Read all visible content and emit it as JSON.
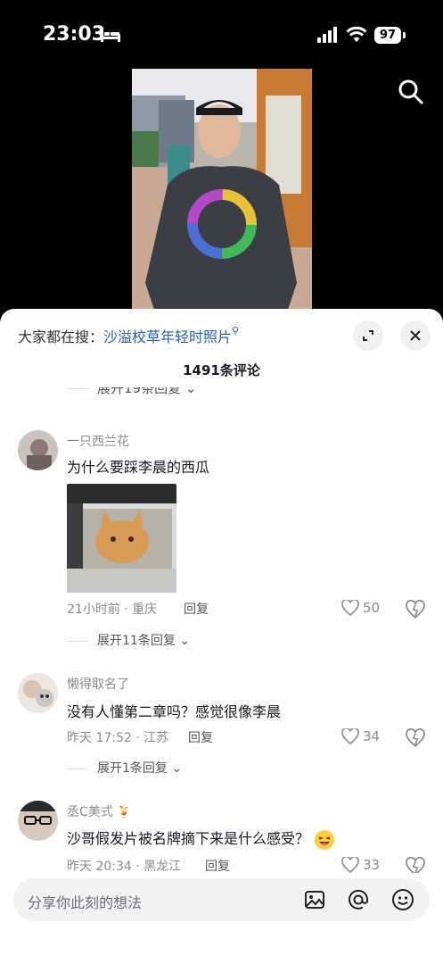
{
  "status_bar": {
    "time": "23:03",
    "battery": "97",
    "icons": [
      "bed-icon",
      "signal-icon",
      "wifi-icon",
      "battery-icon"
    ]
  },
  "video": {
    "search_icon": "search-icon",
    "loading_indicator": "loading-ring"
  },
  "sheet": {
    "search_prefix": "大家都在搜：",
    "search_keyword": "沙溢校草年轻时照片",
    "comment_count": "1491条评论",
    "partial_expand": "展开19条回复"
  },
  "comments": [
    {
      "user": "一只西兰花",
      "text": "为什么要踩李晨的西瓜",
      "time_location": "21小时前 · 重庆",
      "reply": "回复",
      "likes": "50",
      "expand": "展开11条回复"
    },
    {
      "user": "懒得取名了",
      "text": "没有人懂第二章吗？感觉很像李晨",
      "time_location": "昨天 17:52 · 江苏",
      "reply": "回复",
      "likes": "34",
      "expand": "展开1条回复"
    },
    {
      "user": "丞C美式",
      "text": "沙哥假发片被名牌摘下来是什么感受？",
      "time_location": "昨天 20:34 · 黑龙江",
      "reply": "回复",
      "likes": "33"
    }
  ],
  "input_bar": {
    "placeholder": "分享你此刻的想法",
    "icons": [
      "image-icon",
      "at-icon",
      "emoji-icon"
    ]
  },
  "colors": {
    "keyword": "#2b5ea8",
    "secondary_text": "#8a8b91",
    "primary_text": "#161823"
  }
}
